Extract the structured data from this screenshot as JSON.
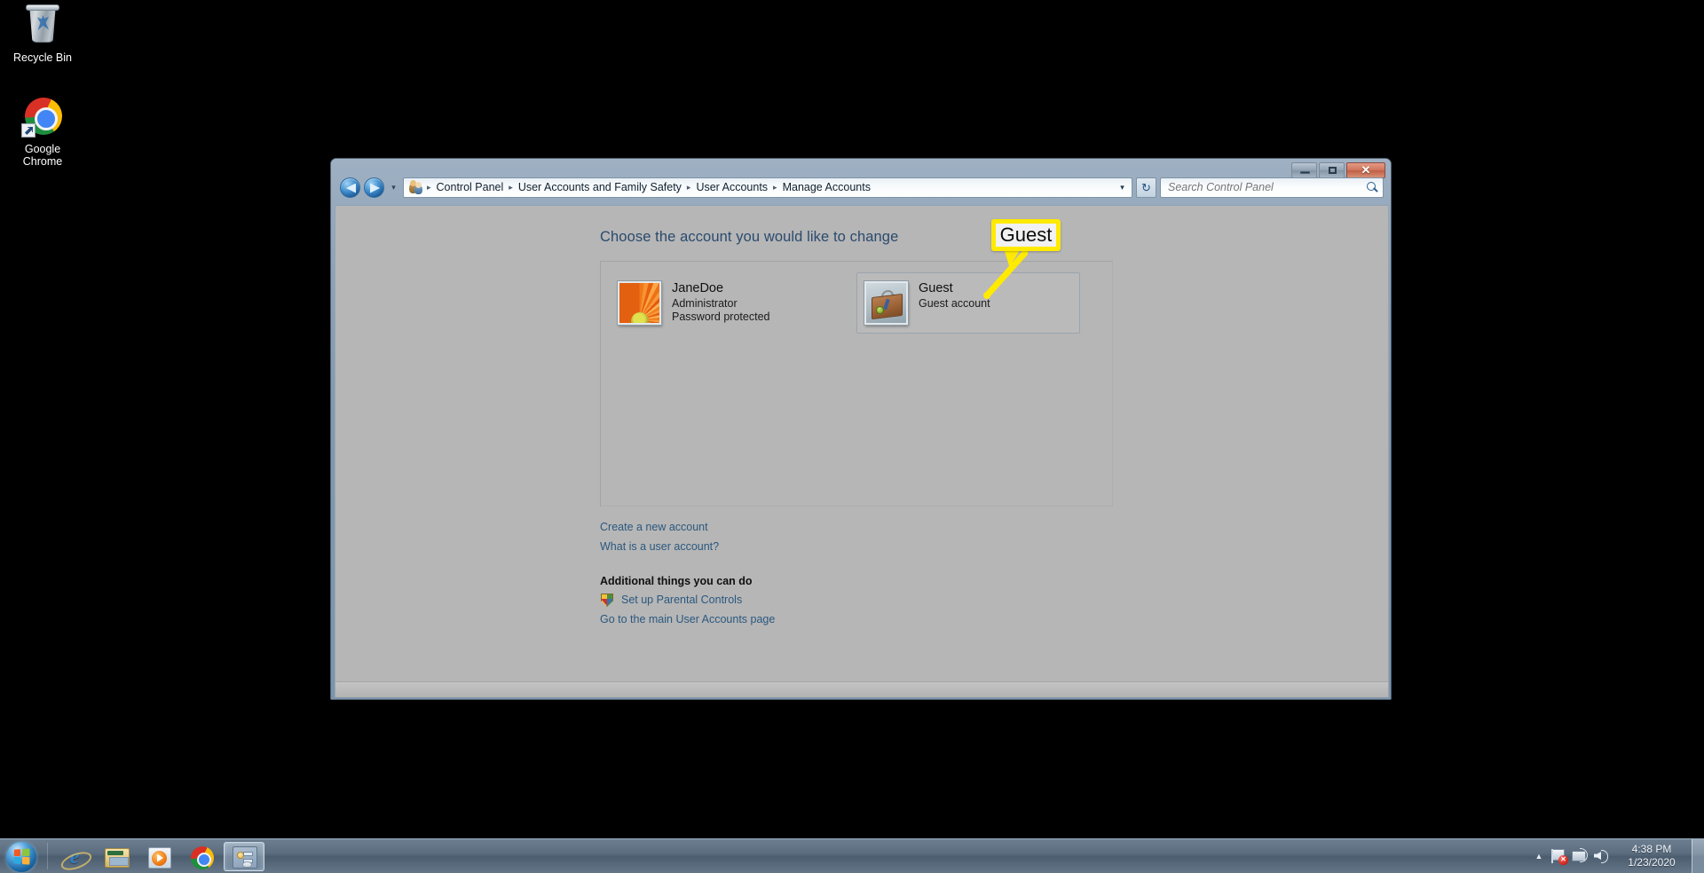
{
  "desktop": {
    "icons": [
      {
        "label": "Recycle Bin",
        "icon": "recycle-bin-icon"
      },
      {
        "label": "Google Chrome",
        "icon": "chrome-icon"
      }
    ]
  },
  "window": {
    "title": "Manage Accounts",
    "controls": {
      "minimize": "–",
      "maximize": "□",
      "close": "✕"
    },
    "nav": {
      "back": "back-button",
      "forward": "forward-button",
      "recent_pages": "▾",
      "address_caret": "▾",
      "refresh": "↻"
    },
    "breadcrumbs": [
      "Control Panel",
      "User Accounts and Family Safety",
      "User Accounts",
      "Manage Accounts"
    ],
    "breadcrumb_separator": "▸",
    "search": {
      "placeholder": "Search Control Panel",
      "value": ""
    }
  },
  "main": {
    "heading": "Choose the account you would like to change",
    "accounts": [
      {
        "name": "JaneDoe",
        "role": "Administrator",
        "status": "Password protected",
        "avatar": "flower-avatar",
        "hovered": false
      },
      {
        "name": "Guest",
        "role": "Guest account",
        "status": "",
        "avatar": "suitcase-avatar",
        "hovered": true
      }
    ],
    "links": [
      "Create a new account",
      "What is a user account?"
    ],
    "additional_section_title": "Additional things you can do",
    "additional_links": [
      {
        "label": "Set up Parental Controls",
        "icon": "shield-icon"
      },
      {
        "label": "Go to the main User Accounts page",
        "icon": ""
      }
    ]
  },
  "annotation": {
    "label": "Guest",
    "border_color": "#ffea00",
    "fill_color": "#f1f1f1",
    "target": "guest-account-tile"
  },
  "taskbar": {
    "start": "start-orb",
    "items": [
      {
        "name": "internet-explorer",
        "active": false
      },
      {
        "name": "windows-explorer",
        "active": false
      },
      {
        "name": "windows-media-player",
        "active": false
      },
      {
        "name": "google-chrome",
        "active": false
      },
      {
        "name": "control-panel",
        "active": true
      }
    ],
    "tray": {
      "chevron": "▲",
      "action_center_badge": "✕",
      "icons": [
        "action-center-flag",
        "network",
        "volume"
      ],
      "time": "4:38 PM",
      "date": "1/23/2020"
    }
  },
  "colors": {
    "annotation_yellow": "#ffea00",
    "link_blue": "#2a587f",
    "heading_blue": "#2a4a6e",
    "window_chrome": "#8299ae",
    "client_gray": "#b6b6b6"
  }
}
